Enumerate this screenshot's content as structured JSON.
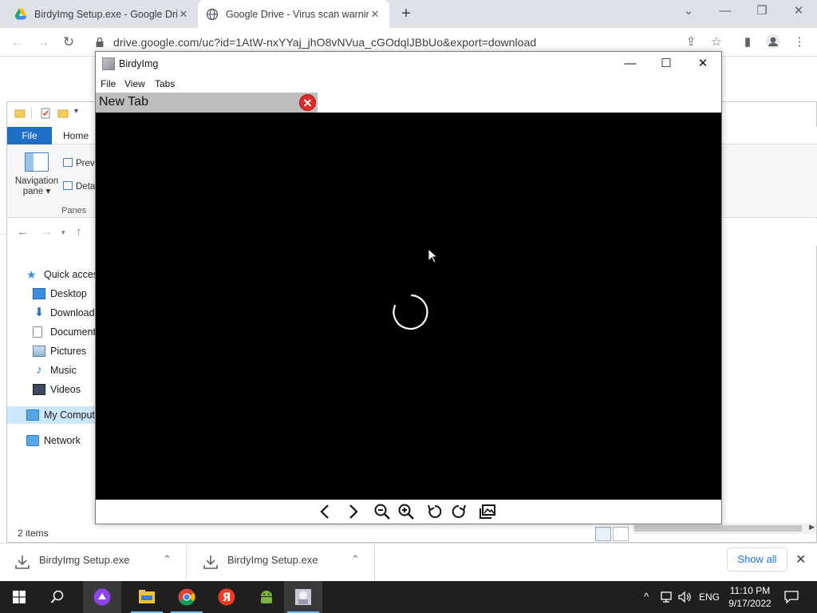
{
  "browser": {
    "tabs": [
      {
        "title": "BirdyImg Setup.exe - Google Dri",
        "icon": "google-drive-icon"
      },
      {
        "title": "Google Drive - Virus scan warnin",
        "icon": "globe-icon"
      }
    ],
    "url": "drive.google.com/uc?id=1AtW-nxYYaj_jhO8vNVua_cGOdqlJBbUo&export=download"
  },
  "explorer": {
    "ribbon_tabs": {
      "file": "File",
      "home": "Home"
    },
    "navigation_pane_label": "Navigation pane",
    "preview_label": "Previ",
    "details_label": "Deta",
    "panes_label": "Panes",
    "tree": [
      {
        "label": "Quick access",
        "icon": "star-icon"
      },
      {
        "label": "Desktop",
        "icon": "desktop-folder-icon"
      },
      {
        "label": "Downloads",
        "icon": "download-arrow-icon"
      },
      {
        "label": "Documents",
        "icon": "document-icon"
      },
      {
        "label": "Pictures",
        "icon": "pictures-icon"
      },
      {
        "label": "Music",
        "icon": "music-note-icon"
      },
      {
        "label": "Videos",
        "icon": "film-icon"
      },
      {
        "label": "My Compute",
        "icon": "computer-icon"
      },
      {
        "label": "Network",
        "icon": "network-icon"
      }
    ],
    "status_count": "2 items"
  },
  "birdy": {
    "title": "BirdyImg",
    "menus": [
      "File",
      "View",
      "Tabs"
    ],
    "tab_label": "New Tab",
    "toolbar_icons": [
      "prev-icon",
      "next-icon",
      "zoom-out-icon",
      "zoom-in-icon",
      "rotate-left-icon",
      "rotate-right-icon",
      "gallery-icon"
    ]
  },
  "downloads": {
    "items": [
      {
        "name": "BirdyImg Setup.exe"
      },
      {
        "name": "BirdyImg Setup.exe"
      }
    ],
    "show_all": "Show all"
  },
  "taskbar": {
    "apps": [
      "start-icon",
      "search-icon",
      "cortana-icon",
      "file-explorer-icon",
      "chrome-icon",
      "yandex-icon",
      "android-icon",
      "birdyimg-icon"
    ],
    "lang": "ENG",
    "time": "11:10 PM",
    "date": "9/17/2022"
  },
  "colors": {
    "explorer_file_tab": "#1e6fc5",
    "tab_close_red": "#e02b2b",
    "link_blue": "#1a73e8",
    "taskbar": "#1f1f1f"
  }
}
